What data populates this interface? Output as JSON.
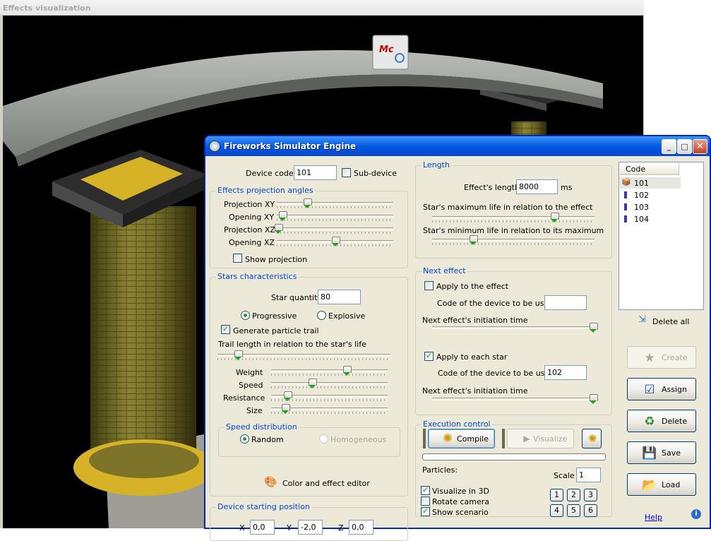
{
  "background_window": {
    "title": "Effects visualization"
  },
  "dialog": {
    "title": "Fireworks Simulator Engine",
    "device_code_label": "Device code",
    "device_code_value": "101",
    "sub_device_label": "Sub-device",
    "sub_device_checked": false,
    "projection": {
      "title": "Effects projection angles",
      "sliders": [
        {
          "label": "Projection XY",
          "value": 0.26
        },
        {
          "label": "Opening XY",
          "value": 0.05
        },
        {
          "label": "Projection XZ",
          "value": 0.01
        },
        {
          "label": "Opening XZ",
          "value": 0.5
        }
      ],
      "show_projection_label": "Show projection",
      "show_projection_checked": false
    },
    "stars": {
      "title": "Stars characteristics",
      "quantity_label": "Star quantity",
      "quantity_value": "80",
      "progressive_label": "Progressive",
      "explosive_label": "Explosive",
      "mode_selected": "Progressive",
      "trail_label": "Generate particle trail",
      "trail_checked": true,
      "trail_length_label": "Trail length in relation to the star's life",
      "trail_length_value": 0.12,
      "sliders": [
        {
          "label": "Weight",
          "value": 0.65
        },
        {
          "label": "Speed",
          "value": 0.35
        },
        {
          "label": "Resistance",
          "value": 0.14
        },
        {
          "label": "Size",
          "value": 0.12
        }
      ],
      "speed_dist": {
        "title": "Speed distribution",
        "random_label": "Random",
        "homogeneous_label": "Homogeneous",
        "selected": "Random"
      },
      "color_editor_label": "Color and effect editor"
    },
    "position": {
      "title": "Device starting position",
      "x_label": "X",
      "x_value": "0,0",
      "y_label": "Y",
      "y_value": "-2,0",
      "z_label": "Z",
      "z_value": "0,0"
    },
    "length": {
      "title": "Length",
      "effect_length_label": "Effect's length",
      "effect_length_value": "8000",
      "unit": "ms",
      "max_life_label": "Star's maximum life in relation to the effect",
      "max_life_value": 0.75,
      "min_life_label": "Star's minimum life in relation to its maximum",
      "min_life_value": 0.25
    },
    "next_effect": {
      "title": "Next effect",
      "apply_effect_label": "Apply to the effect",
      "apply_effect_checked": false,
      "code_label": "Code of the device to be used",
      "code_value_effect": "",
      "init_time_label": "Next effect's initiation time",
      "init_time_effect": 1.0,
      "apply_star_label": "Apply to each star",
      "apply_star_checked": true,
      "code_value_star": "102",
      "init_time_star": 1.0
    },
    "execution": {
      "title": "Execution control",
      "compile_label": "Compile",
      "visualize_label": "Visualize",
      "particles_label": "Particles:",
      "scale_label": "Scale",
      "scale_value": "1",
      "visualize_3d_label": "Visualize in 3D",
      "visualize_3d_checked": true,
      "rotate_camera_label": "Rotate camera",
      "rotate_camera_checked": false,
      "show_scenario_label": "Show scenario",
      "show_scenario_checked": true,
      "view_buttons": [
        "1",
        "2",
        "3",
        "4",
        "5",
        "6"
      ]
    },
    "code_list": {
      "header": "Code",
      "items": [
        "101",
        "102",
        "103",
        "104"
      ],
      "selected": "101"
    },
    "delete_all_label": "Delete all",
    "buttons": {
      "create": "Create",
      "assign": "Assign",
      "delete": "Delete",
      "save": "Save",
      "load": "Load"
    },
    "help_label": "Help"
  },
  "colors": {
    "titlebar": "#0054e3",
    "group_title": "#0046d5",
    "pillar": "#6b6422",
    "sand": "#d6b326"
  }
}
